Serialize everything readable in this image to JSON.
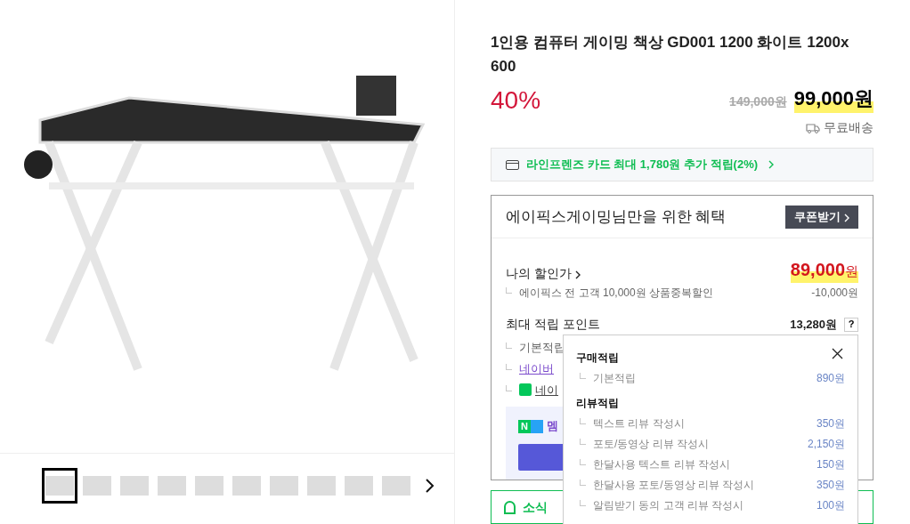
{
  "gallery": {
    "thumbnails": [
      {
        "selected": true
      },
      {
        "selected": false
      },
      {
        "selected": false
      },
      {
        "selected": false
      },
      {
        "selected": false
      },
      {
        "selected": false
      },
      {
        "selected": false
      },
      {
        "selected": false
      },
      {
        "selected": false
      },
      {
        "selected": false
      }
    ]
  },
  "product": {
    "title": "1인용 컴퓨터 게이밍 책상 GD001 1200 화이트 1200x 600",
    "discount": "40%",
    "original_price": "149,000원",
    "price": "99,000",
    "currency": "원",
    "shipping": "무료배송"
  },
  "card_promo": "라인프렌즈 카드 최대 1,780원 추가 적립(2%)",
  "benefits": {
    "title": "에이픽스게이밍님만을 위한 혜택",
    "coupon_button": "쿠폰받기",
    "my_price_label": "나의 할인가",
    "my_price": "89,000",
    "my_price_currency": "원",
    "discount_line": {
      "label": "에이픽스 전 고객 10,000원 상품중복할인",
      "value": "-10,000원"
    },
    "points_label": "최대 적립 포인트",
    "points_value": "13,280원",
    "help": "?",
    "point_lines": [
      {
        "kind": "plain",
        "label": "기본적립"
      },
      {
        "kind": "link",
        "label": "네이버"
      },
      {
        "kind": "npay",
        "label": "네이"
      }
    ],
    "membership": {
      "badge_n": "N",
      "label": "멤"
    }
  },
  "news_box": {
    "label": "소식"
  },
  "popover": {
    "sections": [
      {
        "title": "구매적립",
        "rows": [
          {
            "label": "기본적립",
            "value": "890원"
          }
        ]
      },
      {
        "title": "리뷰적립",
        "rows": [
          {
            "label": "텍스트 리뷰 작성시",
            "value": "350원"
          },
          {
            "label": "포토/동영상 리뷰 작성시",
            "value": "2,150원"
          },
          {
            "label": "한달사용 텍스트 리뷰 작성시",
            "value": "150원"
          },
          {
            "label": "한달사용 포토/동영상 리뷰 작성시",
            "value": "350원"
          },
          {
            "label": "알림받기 동의 고객 리뷰 작성시",
            "value": "100원"
          }
        ]
      }
    ]
  }
}
